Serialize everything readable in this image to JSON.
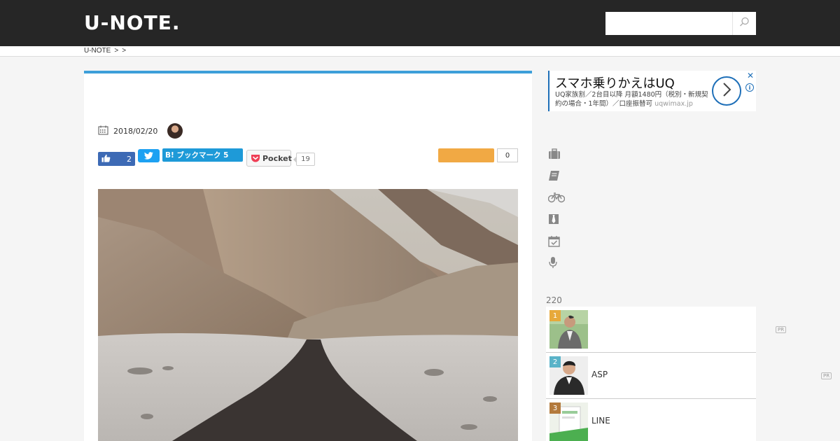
{
  "header": {
    "logo": "U-NOTE.",
    "search": {
      "placeholder": "",
      "button_icon": "search-icon"
    }
  },
  "breadcrumb": {
    "items": [
      "U-NOTE",
      ">",
      ">"
    ]
  },
  "article": {
    "accent_color": "#3d9fd9",
    "date": "2018/02/20",
    "share": {
      "facebook_count": "2",
      "hatena_label": "B! ブックマーク 5",
      "pocket_label": "Pocket",
      "pocket_count": "19",
      "clip_count": "0"
    }
  },
  "ad": {
    "title": "スマホ乗りかえはUQ",
    "description": "UQ家族割／2台目以降 月額1480円（税別・新規契約の場合・1年間）／口座振替可",
    "domain": "uqwimax.jp",
    "close": "✕",
    "info": "i"
  },
  "categories": [
    "briefcase-icon",
    "book-icon",
    "bicycle-icon",
    "tie-icon",
    "calendar-check-icon",
    "microphone-icon"
  ],
  "ranking": {
    "count": "220",
    "items": [
      {
        "rank": "1",
        "title": "",
        "color": "#e7a93b"
      },
      {
        "rank": "2",
        "title": "ASP",
        "color": "#5ab3c8"
      },
      {
        "rank": "3",
        "title": "LINE",
        "color": "#b37a3c"
      }
    ],
    "pr_label": "PR"
  }
}
